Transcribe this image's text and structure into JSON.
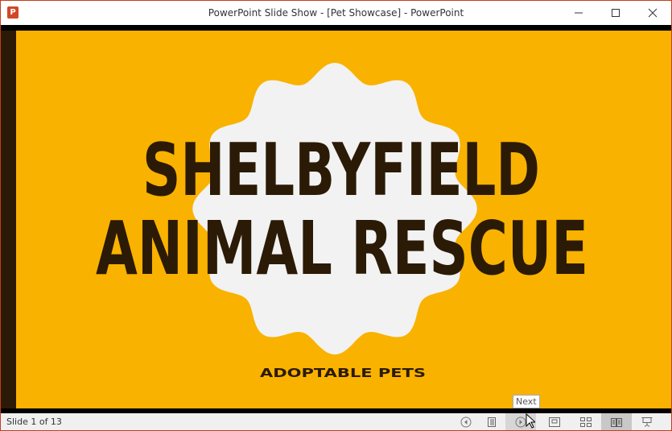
{
  "window": {
    "title": "PowerPoint Slide Show - [Pet Showcase] - PowerPoint",
    "app_icon": "P",
    "border_color": "#c43e1c"
  },
  "slide": {
    "title_line1": "SHELBYFIELD",
    "title_line2": "ANIMAL RESCUE",
    "subtitle": "ADOPTABLE PETS",
    "background": "#f9b200",
    "text_color": "#2b1a05",
    "badge_color": "#f2f2f2"
  },
  "status": {
    "slide_counter": "Slide 1 of 13"
  },
  "tooltip": {
    "text": "Next"
  }
}
